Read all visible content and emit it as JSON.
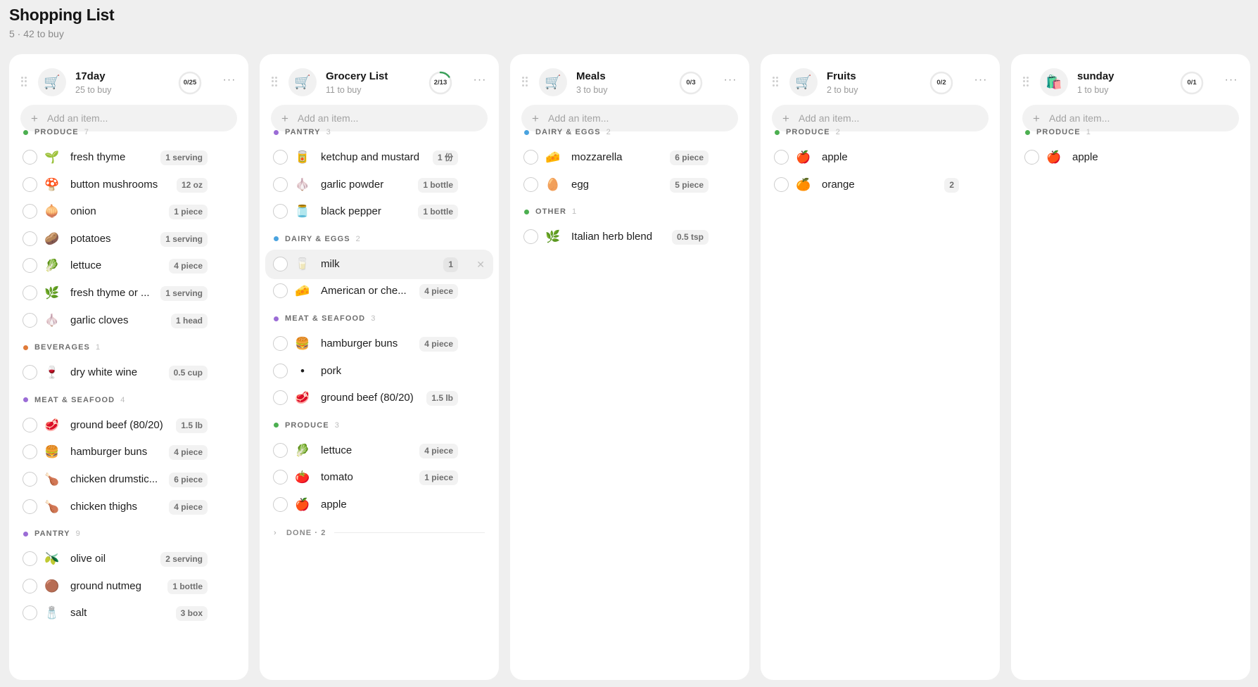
{
  "page": {
    "title": "Shopping List",
    "subtitle": "5 · 42 to buy"
  },
  "ui": {
    "add_placeholder": "Add an item...",
    "menu_glyph": "···",
    "add_glyph": "+",
    "delete_glyph": "✕"
  },
  "colors": {
    "produce": "#4caf50",
    "beverages": "#e07b39",
    "meat": "#9b6cd6",
    "pantry": "#9b6cd6",
    "dairy": "#4aa3df",
    "other": "#4caf50",
    "progress": "#3aa05a"
  },
  "lists": [
    {
      "title": "17day",
      "count": "25 to buy",
      "progress": "0/25",
      "done_fraction": 0,
      "icon": "shopping-cart-icon",
      "emoji": "🛒",
      "sections": [
        {
          "name": "PRODUCE",
          "count": "7",
          "color": "#4caf50",
          "items": [
            {
              "name": "fresh thyme",
              "qty": "1 serving",
              "emoji": "🌱"
            },
            {
              "name": "button mushrooms",
              "qty": "12 oz",
              "emoji": "🍄"
            },
            {
              "name": "onion",
              "qty": "1 piece",
              "emoji": "🧅"
            },
            {
              "name": "potatoes",
              "qty": "1 serving",
              "emoji": "🥔"
            },
            {
              "name": "lettuce",
              "qty": "4 piece",
              "emoji": "🥬"
            },
            {
              "name": "fresh thyme or ...",
              "qty": "1 serving",
              "emoji": "🌿"
            },
            {
              "name": "garlic cloves",
              "qty": "1 head",
              "emoji": "🧄"
            }
          ]
        },
        {
          "name": "BEVERAGES",
          "count": "1",
          "color": "#e07b39",
          "items": [
            {
              "name": "dry white wine",
              "qty": "0.5 cup",
              "emoji": "🍷"
            }
          ]
        },
        {
          "name": "MEAT & SEAFOOD",
          "count": "4",
          "color": "#9b6cd6",
          "items": [
            {
              "name": "ground beef (80/20)",
              "qty": "1.5 lb",
              "emoji": "🥩"
            },
            {
              "name": "hamburger buns",
              "qty": "4 piece",
              "emoji": "🍔"
            },
            {
              "name": "chicken drumstic...",
              "qty": "6 piece",
              "emoji": "🍗"
            },
            {
              "name": "chicken thighs",
              "qty": "4 piece",
              "emoji": "🍗"
            }
          ]
        },
        {
          "name": "PANTRY",
          "count": "9",
          "color": "#9b6cd6",
          "items": [
            {
              "name": "olive oil",
              "qty": "2 serving",
              "emoji": "🫒"
            },
            {
              "name": "ground nutmeg",
              "qty": "1 bottle",
              "emoji": "🟤"
            },
            {
              "name": "salt",
              "qty": "3 box",
              "emoji": "🧂"
            }
          ]
        }
      ]
    },
    {
      "title": "Grocery List",
      "count": "11 to buy",
      "progress": "2/13",
      "done_fraction": 0.154,
      "icon": "shopping-cart-icon",
      "emoji": "🛒",
      "sections": [
        {
          "name": "PANTRY",
          "count": "3",
          "color": "#9b6cd6",
          "items": [
            {
              "name": "ketchup and mustard",
              "qty": "1 份",
              "emoji": "🥫"
            },
            {
              "name": "garlic powder",
              "qty": "1 bottle",
              "emoji": "🧄"
            },
            {
              "name": "black pepper",
              "qty": "1 bottle",
              "emoji": "🫙"
            }
          ]
        },
        {
          "name": "DAIRY & EGGS",
          "count": "2",
          "color": "#4aa3df",
          "items": [
            {
              "name": "milk",
              "qty": "1",
              "emoji": "🥛",
              "hover": true
            },
            {
              "name": "American or che...",
              "qty": "4 piece",
              "emoji": "🧀"
            }
          ]
        },
        {
          "name": "MEAT & SEAFOOD",
          "count": "3",
          "color": "#9b6cd6",
          "items": [
            {
              "name": "hamburger buns",
              "qty": "4 piece",
              "emoji": "🍔"
            },
            {
              "name": "pork",
              "qty": "",
              "emoji": "•"
            },
            {
              "name": "ground beef (80/20)",
              "qty": "1.5 lb",
              "emoji": "🥩"
            }
          ]
        },
        {
          "name": "PRODUCE",
          "count": "3",
          "color": "#4caf50",
          "items": [
            {
              "name": "lettuce",
              "qty": "4 piece",
              "emoji": "🥬"
            },
            {
              "name": "tomato",
              "qty": "1 piece",
              "emoji": "🍅"
            },
            {
              "name": "apple",
              "qty": "",
              "emoji": "🍎"
            }
          ]
        }
      ],
      "done_label": "DONE · 2"
    },
    {
      "title": "Meals",
      "count": "3 to buy",
      "progress": "0/3",
      "done_fraction": 0,
      "icon": "shopping-cart-icon",
      "emoji": "🛒",
      "sections": [
        {
          "name": "DAIRY & EGGS",
          "count": "2",
          "color": "#4aa3df",
          "items": [
            {
              "name": "mozzarella",
              "qty": "6 piece",
              "emoji": "🧀"
            },
            {
              "name": "egg",
              "qty": "5 piece",
              "emoji": "🥚"
            }
          ]
        },
        {
          "name": "OTHER",
          "count": "1",
          "color": "#4caf50",
          "items": [
            {
              "name": "Italian herb blend",
              "qty": "0.5 tsp",
              "emoji": "🌿"
            }
          ]
        }
      ]
    },
    {
      "title": "Fruits",
      "count": "2 to buy",
      "progress": "0/2",
      "done_fraction": 0,
      "icon": "shopping-cart-icon",
      "emoji": "🛒",
      "sections": [
        {
          "name": "PRODUCE",
          "count": "2",
          "color": "#4caf50",
          "items": [
            {
              "name": "apple",
              "qty": "",
              "emoji": "🍎"
            },
            {
              "name": "orange",
              "qty": "2",
              "emoji": "🍊"
            }
          ]
        }
      ]
    },
    {
      "title": "sunday",
      "count": "1 to buy",
      "progress": "0/1",
      "done_fraction": 0,
      "icon": "shopping-bags-icon",
      "emoji": "🛍️",
      "sections": [
        {
          "name": "PRODUCE",
          "count": "1",
          "color": "#4caf50",
          "items": [
            {
              "name": "apple",
              "qty": "",
              "emoji": "🍎"
            }
          ]
        }
      ]
    }
  ]
}
